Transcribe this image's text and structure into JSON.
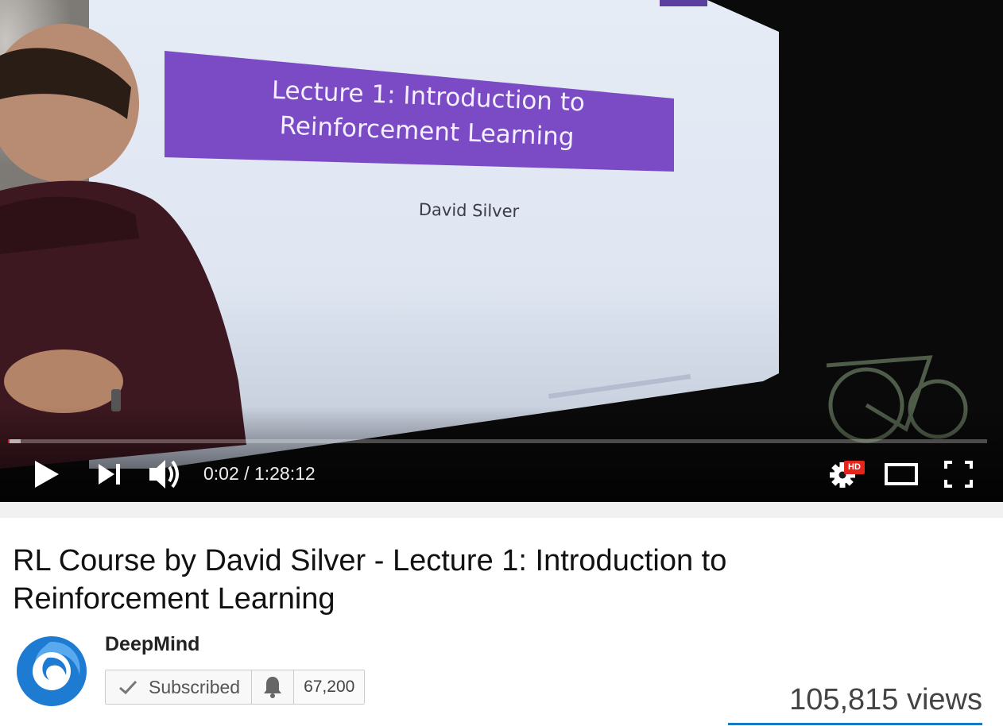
{
  "player": {
    "slide": {
      "title": "Lecture 1: Introduction to Reinforcement Learning",
      "author": "David Silver"
    },
    "progress": {
      "played_fraction": 0.0004,
      "loaded_fraction": 0.013
    },
    "time": {
      "current": "0:02",
      "separator": " / ",
      "duration": "1:28:12"
    },
    "hd_label": "HD",
    "icons": {
      "play": "play-icon",
      "next": "next-icon",
      "volume": "volume-icon",
      "settings": "gear-icon",
      "theater": "theater-mode-icon",
      "fullscreen": "fullscreen-icon"
    }
  },
  "video": {
    "title": "RL Course by David Silver - Lecture 1: Introduction to Reinforcement Learning",
    "views": "105,815 views"
  },
  "channel": {
    "name": "DeepMind",
    "subscribe_label": "Subscribed",
    "subscriber_count": "67,200",
    "icons": {
      "check": "check-icon",
      "bell": "bell-icon",
      "avatar": "deepmind-logo"
    }
  },
  "colors": {
    "progress_red": "#cc181e",
    "hd_red": "#e3251c",
    "slide_purple": "#7a4bc4",
    "sentiment_blue": "#167ac6"
  }
}
